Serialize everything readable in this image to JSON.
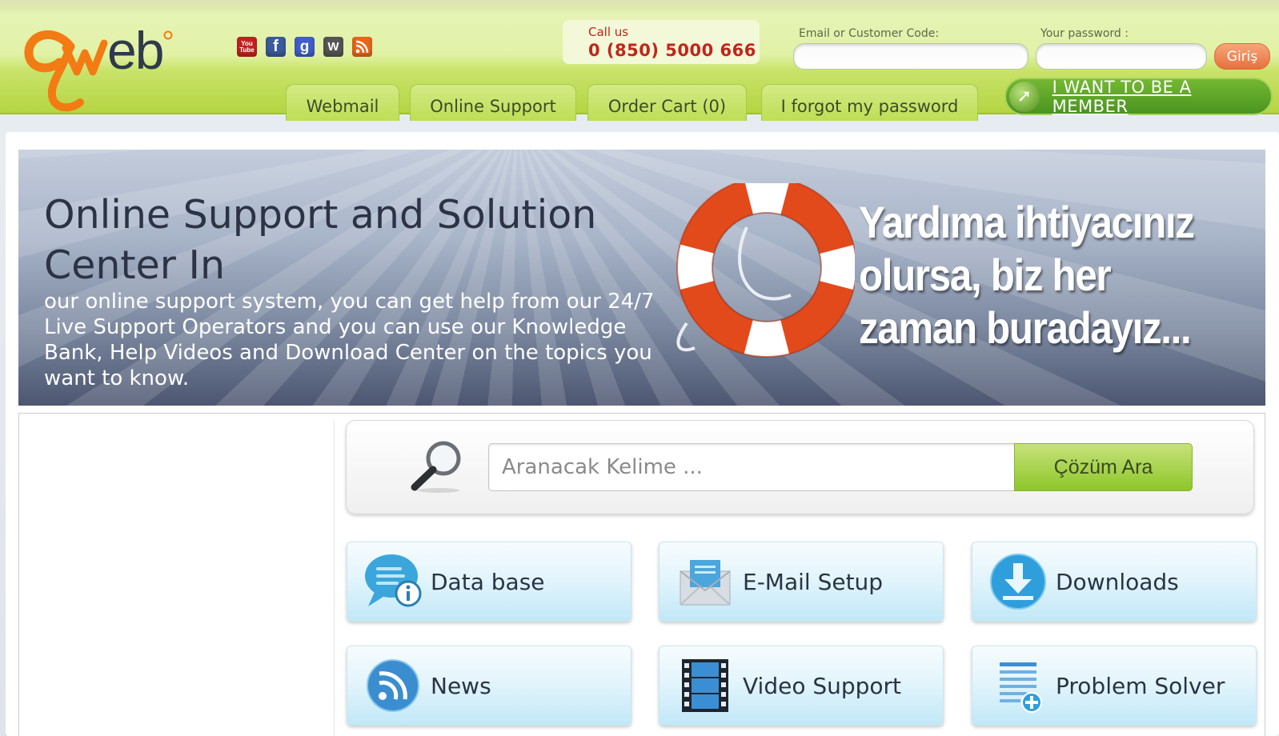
{
  "header": {
    "logo_text": "eb",
    "social_icons": [
      "youtube-icon",
      "facebook-icon",
      "google-icon",
      "wordpress-icon",
      "rss-icon"
    ],
    "youtube_icon_text": "You Tube",
    "callus_label": "Call us",
    "callus_phone": "0 (850) 5000 666",
    "email_label": "Email or Customer Code:",
    "password_label": "Your password :",
    "login_button": "Giriş",
    "tabs": [
      {
        "label": "Webmail"
      },
      {
        "label": "Online Support"
      },
      {
        "label": "Order Cart (0)"
      },
      {
        "label": "I forgot my password"
      }
    ],
    "member_button": "I WANT TO BE A MEMBER"
  },
  "banner": {
    "title": "Online Support and Solution Center In",
    "body": "our online support system, you can get help from our 24/7 Live Support Operators and you can use our Knowledge Bank, Help Videos and Download Center on the topics you want to know.",
    "slogan": "Yardıma ihtiyacınız olursa, biz her zaman buradayız..."
  },
  "search": {
    "placeholder": "Aranacak Kelime ...",
    "button": "Çözüm Ara"
  },
  "cards": [
    {
      "label": "Data base",
      "icon": "database-info-icon"
    },
    {
      "label": "E-Mail Setup",
      "icon": "email-envelope-icon"
    },
    {
      "label": "Downloads",
      "icon": "download-icon"
    },
    {
      "label": "News",
      "icon": "rss-news-icon"
    },
    {
      "label": "Video Support",
      "icon": "film-strip-icon"
    },
    {
      "label": "Problem Solver",
      "icon": "document-add-icon"
    }
  ],
  "colors": {
    "header_green": "#b3d33c",
    "phone_red": "#c0261a",
    "login_orange": "#e8703e",
    "member_green": "#4a9420",
    "card_blue": "#c1e8f7"
  }
}
